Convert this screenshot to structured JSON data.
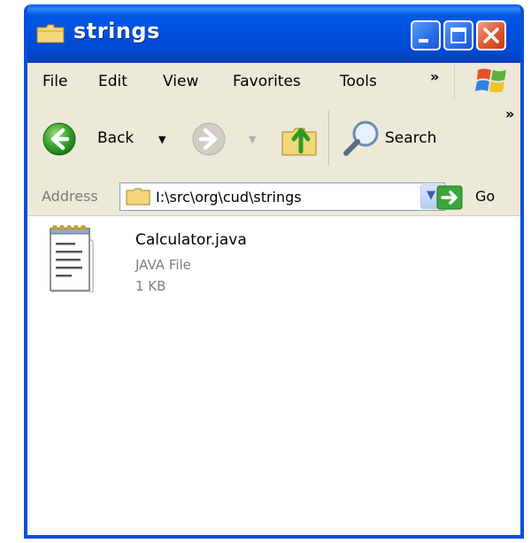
{
  "window": {
    "title": "strings"
  },
  "menubar": {
    "items": [
      "File",
      "Edit",
      "View",
      "Favorites",
      "Tools"
    ],
    "more": "»"
  },
  "toolbar": {
    "back_label": "Back",
    "search_label": "Search",
    "more": "»",
    "dropdown_arrow": "▼"
  },
  "address": {
    "label": "Address",
    "value": "I:\\src\\org\\cud\\strings",
    "go_label": "Go"
  },
  "files": [
    {
      "name": "Calculator.java",
      "type": "JAVA File",
      "size": "1 KB"
    }
  ],
  "colors": {
    "titlebar": "#0050de",
    "window_border": "#0a4fd6",
    "chrome": "#ece9d8",
    "content": "#ffffff",
    "close_button": "#e0582e",
    "back_green": "#2fa02a",
    "go_green": "#3aa63a"
  },
  "icons": {
    "title": "folder-icon",
    "minimize": "minimize-icon",
    "maximize": "maximize-icon",
    "close": "close-icon",
    "logo": "windows-logo-icon",
    "back": "back-arrow-icon",
    "forward": "forward-arrow-icon",
    "up": "folder-up-icon",
    "search": "magnifier-icon",
    "address_folder": "folder-icon",
    "go": "go-arrow-icon",
    "file": "text-file-icon"
  }
}
